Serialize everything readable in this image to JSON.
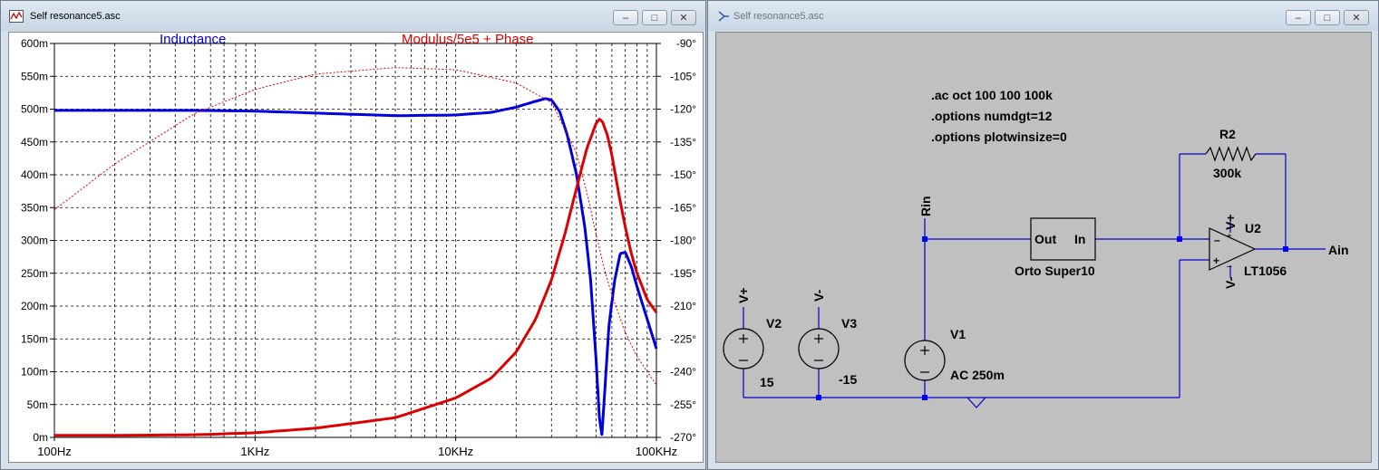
{
  "plot_window": {
    "title": "Self resonance5.asc",
    "buttons": {
      "minimize": "–",
      "maximize": "□",
      "close": "✕"
    }
  },
  "schematic_window": {
    "title": "Self resonance5.asc",
    "buttons": {
      "minimize": "–",
      "maximize": "□",
      "close": "✕"
    }
  },
  "chart_data": {
    "type": "line",
    "x_scale": "log",
    "xlim": [
      100,
      100000
    ],
    "x_ticks": [
      {
        "value": 100,
        "label": "100Hz"
      },
      {
        "value": 1000,
        "label": "1KHz"
      },
      {
        "value": 10000,
        "label": "10KHz"
      },
      {
        "value": 100000,
        "label": "100KHz"
      }
    ],
    "left_axis": {
      "ylim": [
        0,
        0.6
      ],
      "ticks": [
        "0m",
        "50m",
        "100m",
        "150m",
        "200m",
        "250m",
        "300m",
        "350m",
        "400m",
        "450m",
        "500m",
        "550m",
        "600m"
      ]
    },
    "right_axis": {
      "ylim": [
        -270,
        -90
      ],
      "ticks": [
        "-270°",
        "-255°",
        "-240°",
        "-225°",
        "-210°",
        "-195°",
        "-180°",
        "-165°",
        "-150°",
        "-135°",
        "-120°",
        "-105°",
        "-90°"
      ]
    },
    "grid": true,
    "legend_labels": {
      "left": "Inductance",
      "right": "Modulus/5e5 + Phase"
    },
    "colors": {
      "inductance": "#0000dd",
      "modulus": "#dd0000",
      "phase": "#dd0000"
    },
    "series": [
      {
        "name": "Inductance",
        "axis": "left",
        "x": [
          100,
          200,
          500,
          1000,
          2000,
          5000,
          10000,
          15000,
          20000,
          25000,
          28000,
          30000,
          33000,
          36000,
          40000,
          44000,
          47000,
          50000,
          52000,
          53500,
          55000,
          58000,
          62000,
          66000,
          70000,
          75000,
          80000,
          90000,
          100000
        ],
        "y": [
          0.498,
          0.498,
          0.498,
          0.497,
          0.494,
          0.49,
          0.491,
          0.495,
          0.503,
          0.512,
          0.516,
          0.514,
          0.496,
          0.46,
          0.4,
          0.32,
          0.24,
          0.12,
          0.03,
          0.003,
          0.06,
          0.17,
          0.24,
          0.28,
          0.282,
          0.26,
          0.23,
          0.18,
          0.135
        ]
      },
      {
        "name": "Modulus/5e5",
        "axis": "left",
        "x": [
          100,
          200,
          500,
          1000,
          2000,
          5000,
          10000,
          15000,
          20000,
          25000,
          30000,
          35000,
          40000,
          45000,
          50000,
          52000,
          54000,
          57000,
          60000,
          65000,
          70000,
          75000,
          80000,
          90000,
          100000
        ],
        "y": [
          0.003,
          0.003,
          0.004,
          0.007,
          0.014,
          0.03,
          0.06,
          0.09,
          0.13,
          0.18,
          0.24,
          0.31,
          0.38,
          0.44,
          0.478,
          0.485,
          0.48,
          0.46,
          0.43,
          0.37,
          0.32,
          0.28,
          0.25,
          0.21,
          0.19
        ]
      },
      {
        "name": "Phase",
        "axis": "right",
        "dashed": true,
        "x": [
          100,
          200,
          500,
          1000,
          2000,
          5000,
          10000,
          20000,
          30000,
          40000,
          45000,
          50000,
          55000,
          60000,
          70000,
          80000,
          90000,
          100000
        ],
        "y": [
          -166,
          -145,
          -122,
          -111,
          -104,
          -101,
          -102,
          -108,
          -117,
          -140,
          -158,
          -177,
          -193,
          -205,
          -222,
          -233,
          -240,
          -246
        ]
      }
    ]
  },
  "schematic": {
    "directives": [
      ".ac oct 100 100 100k",
      ".options numdgt=12",
      ".options plotwinsize=0"
    ],
    "r2": {
      "name": "R2",
      "value": "300k"
    },
    "u2": {
      "name": "U2",
      "part": "LT1056",
      "vplus": "V+",
      "vminus": "V-",
      "plus": "+",
      "minus": "–"
    },
    "block": {
      "out": "Out",
      "in": "In",
      "name": "Orto Super10"
    },
    "labels": {
      "rin": "Rin",
      "ain": "Ain",
      "vplus": "V+",
      "vminus": "V-"
    },
    "v1": {
      "name": "V1",
      "value": "AC 250m"
    },
    "v2": {
      "name": "V2",
      "value": "15"
    },
    "v3": {
      "name": "V3",
      "value": "-15"
    },
    "wire_color": "#0000cc",
    "node_color": "#0000ff"
  }
}
